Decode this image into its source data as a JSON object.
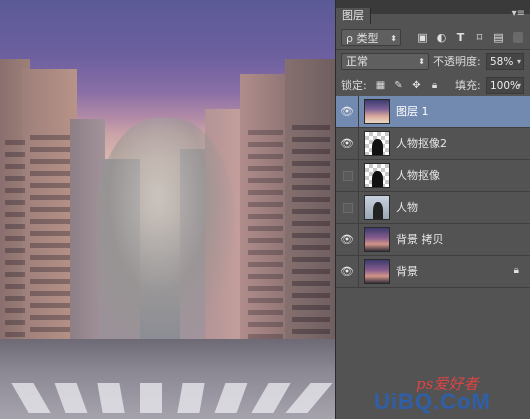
{
  "panel": {
    "tab_label": "图层",
    "menu_glyph": "▾≡",
    "filter": {
      "kind_label": "类型",
      "search_glyph": "ρ",
      "caret": "⬍",
      "icons": [
        "image-filter-icon",
        "adjustment-filter-icon",
        "type-filter-icon",
        "shape-filter-icon",
        "smartobject-filter-icon"
      ]
    },
    "blend_mode": "正常",
    "opacity_label": "不透明度:",
    "opacity_value": "58%",
    "lock_label": "锁定:",
    "fill_label": "填充:",
    "fill_value": "100%",
    "caret": "▾"
  },
  "layers": [
    {
      "name": "图层 1",
      "visible": true,
      "selected": true,
      "thumb": "sky"
    },
    {
      "name": "人物抠像2",
      "visible": true,
      "selected": false,
      "thumb": "cutout"
    },
    {
      "name": "人物抠像",
      "visible": false,
      "selected": false,
      "thumb": "cutout"
    },
    {
      "name": "人物",
      "visible": false,
      "selected": false,
      "thumb": "photo-person"
    },
    {
      "name": "背景 拷贝",
      "visible": true,
      "selected": false,
      "thumb": "city"
    },
    {
      "name": "背景",
      "visible": true,
      "selected": false,
      "thumb": "city",
      "locked": true
    }
  ],
  "watermark": {
    "top": "ps爱好者",
    "main": "UiBQ.CoM",
    "cn": ""
  },
  "colors": {
    "panel_bg": "#535353",
    "selected_row": "#738ab0",
    "watermark_blue": "#2e5fa8"
  }
}
